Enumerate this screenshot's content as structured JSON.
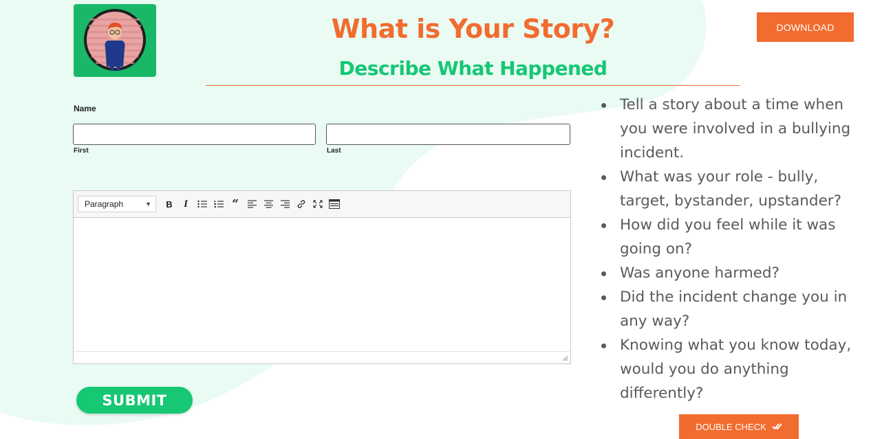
{
  "header": {
    "title": "What is Your Story?",
    "subtitle": "Describe What Happened",
    "download_label": "DOWNLOAD"
  },
  "form": {
    "name_label": "Name",
    "first": {
      "label": "First",
      "value": "",
      "placeholder": ""
    },
    "last": {
      "label": "Last",
      "value": "",
      "placeholder": ""
    },
    "editor": {
      "format_value": "Paragraph",
      "toolbar": [
        "bold-icon",
        "italic-icon",
        "bullet-list-icon",
        "numbered-list-icon",
        "blockquote-icon",
        "align-left-icon",
        "align-center-icon",
        "align-right-icon",
        "link-icon",
        "fullscreen-icon",
        "toolbar-toggle-icon"
      ],
      "content": ""
    },
    "submit_label": "SUBMIT"
  },
  "prompts": [
    "Tell a story about a time when you were involved in a bullying incident.",
    "What was your role - bully, target, bystander, upstander?",
    "How did you feel while it was going on?",
    "Was anyone harmed?",
    "Did the incident change you in any way?",
    "Knowing what you know today, would you do anything differently?"
  ],
  "double_check_label": "DOUBLE CHECK",
  "colors": {
    "accent_orange": "#f26b2f",
    "accent_green": "#16c774",
    "background_blob": "#e9fbf2"
  }
}
